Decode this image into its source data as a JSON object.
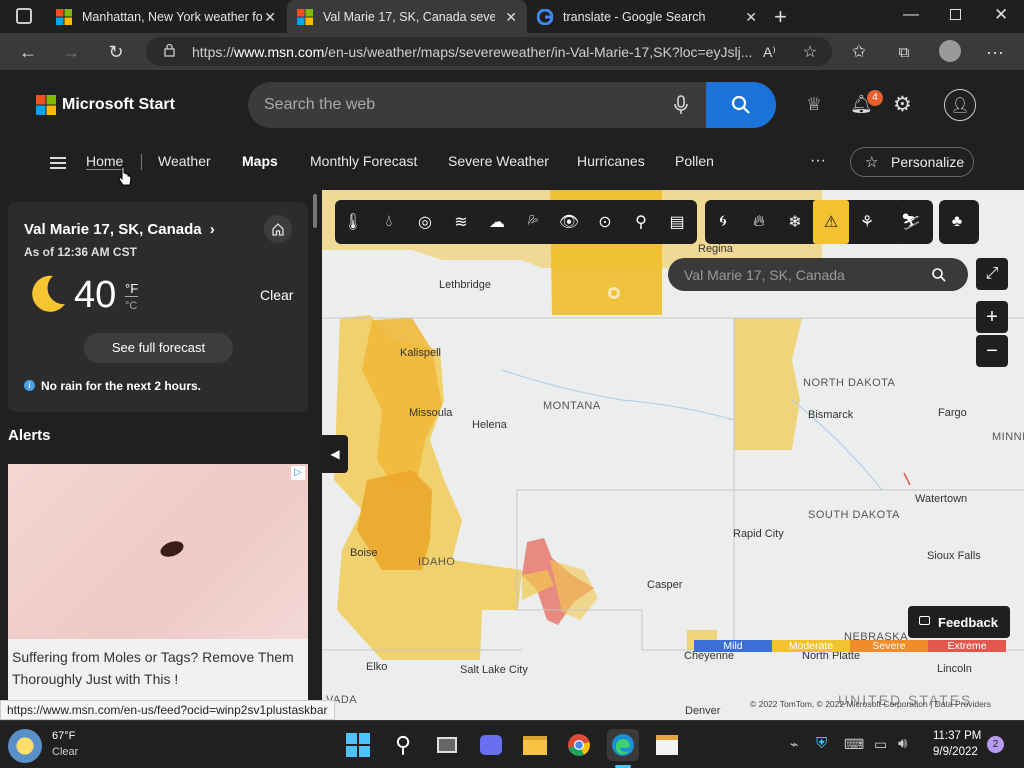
{
  "tabs": [
    {
      "title": "Manhattan, New York weather fo",
      "active": false
    },
    {
      "title": "Val Marie 17, SK, Canada severe",
      "active": true
    },
    {
      "title": "translate - Google Search",
      "active": false
    }
  ],
  "address": {
    "url_prefix": "https://",
    "url_host": "www.msn.com",
    "url_path": "/en-us/weather/maps/severeweather/in-Val-Marie-17,SK?loc=eyJslj..."
  },
  "header": {
    "brand": "Microsoft Start",
    "search_placeholder": "Search the web",
    "notification_count": "4"
  },
  "nav": {
    "items": [
      "Home",
      "Weather",
      "Maps",
      "Monthly Forecast",
      "Severe Weather",
      "Hurricanes",
      "Pollen"
    ],
    "more": "···",
    "personalize": "Personalize"
  },
  "weather_card": {
    "location": "Val Marie 17, SK, Canada",
    "as_of": "As of 12:36 AM CST",
    "temperature": "40",
    "unit_f": "°F",
    "unit_c": "°C",
    "condition": "Clear",
    "forecast_button": "See full forecast",
    "rain_note": "No rain for the next 2 hours."
  },
  "alerts": {
    "heading": "Alerts"
  },
  "ad": {
    "headline": "Suffering from Moles or Tags? Remove Them Thoroughly Just with This !"
  },
  "map": {
    "search_placeholder": "Val Marie 17, SK, Canada",
    "labels": {
      "regina": "Regina",
      "lethbridge": "Lethbridge",
      "kalispell": "Kalispell",
      "missoula": "Missoula",
      "helena": "Helena",
      "montana": "MONTANA",
      "north_dakota": "NORTH DAKOTA",
      "bismarck": "Bismarck",
      "fargo": "Fargo",
      "minn": "MINNI",
      "watertown": "Watertown",
      "south_dakota": "SOUTH DAKOTA",
      "rapid_city": "Rapid City",
      "sioux_falls": "Sioux Falls",
      "boise": "Boise",
      "idaho": "IDAHO",
      "casper": "Casper",
      "nebraska": "NEBRASKA",
      "cheyenne": "Cheyenne",
      "north_platte": "North Platte",
      "lincoln": "Lincoln",
      "elko": "Elko",
      "salt_lake_city": "Salt Lake City",
      "nevada": "VADA",
      "denver": "Denver",
      "united_states": "UNITED STATES"
    },
    "legend": [
      {
        "label": "Mild",
        "color": "#3a6fd8"
      },
      {
        "label": "Moderate",
        "color": "#f2c230"
      },
      {
        "label": "Severe",
        "color": "#f08c2a"
      },
      {
        "label": "Extreme",
        "color": "#e4574c"
      }
    ],
    "feedback": "Feedback",
    "attribution": "© 2022 TomTom, © 2022 Microsoft Corporation | Data Providers"
  },
  "status_url": "https://www.msn.com/en-us/feed?ocid=winp2sv1plustaskbar",
  "taskbar": {
    "weather_temp": "67°F",
    "weather_cond": "Clear",
    "time": "11:37 PM",
    "date": "9/9/2022",
    "notification_count": "2"
  },
  "colors": {
    "accent": "#1a73d8",
    "alert_active": "#f2c230",
    "moderate_fill": "#f2c94c",
    "severe_fill": "#eba72a",
    "extreme_fill": "#e88a7f"
  }
}
